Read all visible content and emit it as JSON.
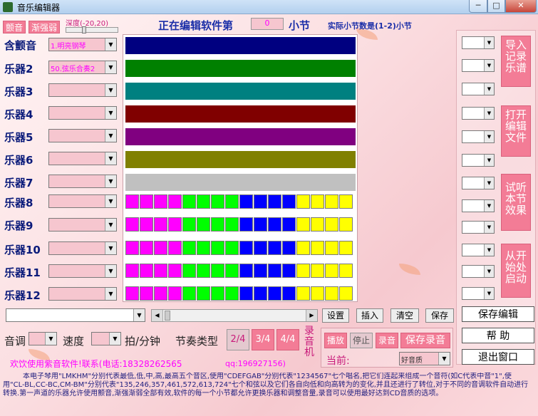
{
  "window": {
    "title": "音乐编辑器",
    "minimize": "─",
    "maximize": "□",
    "close": "✕"
  },
  "top": {
    "btn_vibrato": "颤音",
    "btn_fade": "渐强弱",
    "depth_label": "深度(-20,20)",
    "heading": "正在编辑软件第",
    "measure_value": "0",
    "measure_unit": "小节",
    "measure_note": "实际小节数是(1-2)小节"
  },
  "instruments": [
    {
      "label": "含颤音",
      "value": "1.明亮钢琴"
    },
    {
      "label": "乐器2",
      "value": "50.弦乐合奏2"
    },
    {
      "label": "乐器3",
      "value": ""
    },
    {
      "label": "乐器4",
      "value": ""
    },
    {
      "label": "乐器5",
      "value": ""
    },
    {
      "label": "乐器6",
      "value": ""
    },
    {
      "label": "乐器7",
      "value": ""
    },
    {
      "label": "乐器8",
      "value": ""
    },
    {
      "label": "乐器9",
      "value": ""
    },
    {
      "label": "乐器10",
      "value": ""
    },
    {
      "label": "乐器11",
      "value": ""
    },
    {
      "label": "乐器12",
      "value": ""
    }
  ],
  "colors": {
    "bars": [
      "#000080",
      "#008000",
      "#008080",
      "#800000",
      "#800080",
      "#808000",
      "#c0c0c0"
    ],
    "groups": [
      "#ff00ff",
      "#00ff00",
      "#0000ff",
      "#ffff00"
    ]
  },
  "side": {
    "import": "导入记录乐谱",
    "open": "打开编辑文件",
    "preview": "试听本节效果",
    "play_start": "从开始处启动",
    "save_edit": "保存编辑",
    "help": "帮 助",
    "exit": "退出窗口"
  },
  "toolbar": {
    "settings": "设置",
    "insert": "插入",
    "clear": "清空",
    "save": "保存"
  },
  "controls": {
    "tone_label": "音调",
    "speed_label": "速度",
    "bpm_label": "拍/分钟",
    "rhythm_label": "节奏类型",
    "rhythm_options": [
      "2/4",
      "3/4",
      "4/4"
    ],
    "recorder_label": "录音机",
    "btn_play": "播放",
    "btn_stop": "停止",
    "btn_record": "录音",
    "btn_save_record": "保存录音",
    "current_label": "当前:",
    "quality_value": "好音质"
  },
  "footer": {
    "welcome": "欢饮使用紫音软件!联系(电话:18328262565",
    "qq": "qq:196927156)",
    "description": "本电子琴用\"LMKHM\"分别代表最低,低,中,高,最高五个音区,使用\"CDEFGAB\"分别代表\"1234567\"七个唱名,把它们连起来组成一个音符(如C代表中音\"1\",使用\"CL-BL,CC-BC,CM-BM\"分别代表\"135,246,357,461,572,613,724\"七个和弦以及它们各自向低和向高转为的变化,并且还进行了转位,对于不同的音调软件自动进行转换.第一声道的乐器允许使用颤音,渐强渐弱全部有效,软件的每一个小节都允许更换乐器和调整音量,录音可以使用最好达到CD音质的选项。"
  }
}
